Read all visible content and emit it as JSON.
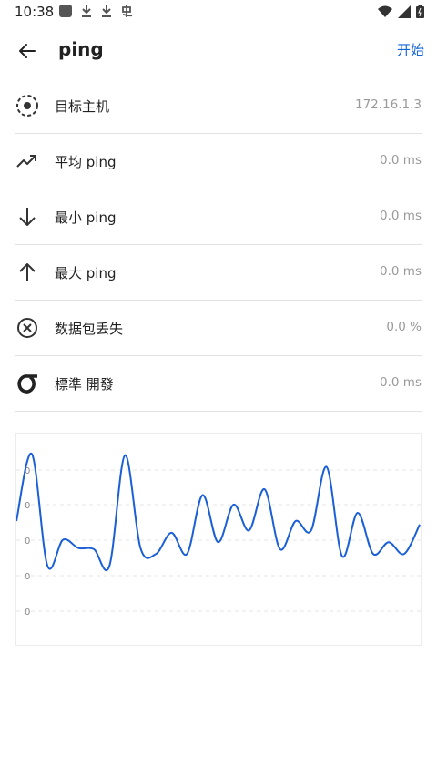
{
  "status": {
    "time": "10:38",
    "left_icons": [
      "app-square-icon",
      "download-icon",
      "download-icon",
      "bug-icon"
    ],
    "right_icons": [
      "wifi-icon",
      "signal-icon",
      "battery-icon"
    ]
  },
  "header": {
    "title": "ping",
    "action_label": "开始"
  },
  "stats": [
    {
      "icon": "target-icon",
      "label": "目标主机",
      "value": "172.16.1.3"
    },
    {
      "icon": "trending-up-icon",
      "label": "平均 ping",
      "value": "0.0 ms"
    },
    {
      "icon": "arrow-down-icon",
      "label": "最小 ping",
      "value": "0.0 ms"
    },
    {
      "icon": "arrow-up-icon",
      "label": "最大 ping",
      "value": "0.0 ms"
    },
    {
      "icon": "cancel-circle-icon",
      "label": "数据包丢失",
      "value": "0.0 %"
    },
    {
      "icon": "sigma-icon",
      "label": "標準 開發",
      "value": "0.0 ms"
    }
  ],
  "chart_data": {
    "type": "line",
    "y_tick_labels": [
      "0",
      "0",
      "0",
      "0",
      "0"
    ],
    "grid": true,
    "line_color": "#1a5fd6",
    "series": [
      {
        "y": [
          0.38,
          0.95,
          0.0,
          0.22,
          0.15,
          0.14,
          0.0,
          0.94,
          0.15,
          0.1,
          0.28,
          0.1,
          0.6,
          0.2,
          0.52,
          0.3,
          0.65,
          0.14,
          0.38,
          0.3,
          0.84,
          0.08,
          0.45,
          0.1,
          0.2,
          0.1,
          0.35
        ]
      }
    ]
  }
}
